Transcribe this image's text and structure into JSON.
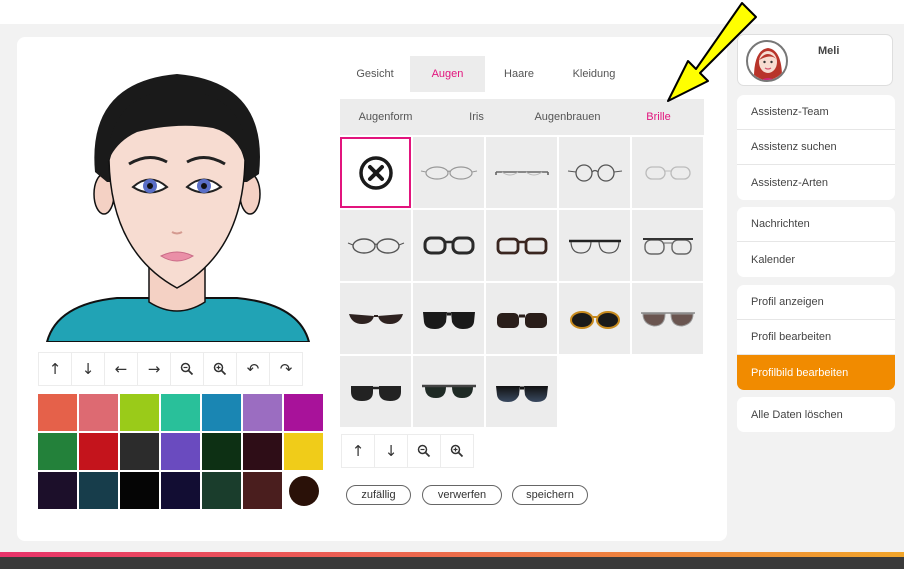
{
  "colors": {
    "accent": "#e2147d",
    "active_nav": "#f18b00",
    "annotation_arrow": "#ffff00"
  },
  "avatar": {
    "icon": "female-face-avatar"
  },
  "editor": {
    "move_tools": [
      {
        "icon": "arrow-up-icon",
        "glyph": "↑"
      },
      {
        "icon": "arrow-down-icon",
        "glyph": "↓"
      },
      {
        "icon": "arrow-left-icon",
        "glyph": "←"
      },
      {
        "icon": "arrow-right-icon",
        "glyph": "→"
      },
      {
        "icon": "zoom-out-icon",
        "glyph": "zoom-out"
      },
      {
        "icon": "zoom-in-icon",
        "glyph": "zoom-in"
      },
      {
        "icon": "rotate-left-icon",
        "glyph": "↶"
      },
      {
        "icon": "rotate-right-icon",
        "glyph": "↷"
      }
    ],
    "palette": [
      "#e5614a",
      "#dd6a72",
      "#9acb19",
      "#29c09a",
      "#1a86b3",
      "#9b6dc1",
      "#a8129a",
      "#23813a",
      "#c4141c",
      "#2c2c2c",
      "#6a4bbf",
      "#0d3014",
      "#2e0d17",
      "#f0cc19",
      "#1c0f2a",
      "#173d4b",
      "#050505",
      "#120d33",
      "#1a3d2c",
      "#4a1e1e",
      "#2a1108"
    ]
  },
  "tabs": {
    "main": [
      {
        "label": "Gesicht",
        "active": false
      },
      {
        "label": "Augen",
        "active": true
      },
      {
        "label": "Haare",
        "active": false
      },
      {
        "label": "Kleidung",
        "active": false
      }
    ],
    "sub": [
      {
        "label": "Augenform",
        "active": false
      },
      {
        "label": "Iris",
        "active": false
      },
      {
        "label": "Augenbrauen",
        "active": false
      },
      {
        "label": "Brille",
        "active": true
      }
    ]
  },
  "glasses": {
    "none_icon": "no-glasses-icon",
    "items": [
      "none",
      "thin-oval",
      "rimless-bar",
      "round-wire",
      "thin-light",
      "wide-oval",
      "thick-dark",
      "thick-brown",
      "browline",
      "clubmaster",
      "sunglasses-cat",
      "sunglasses-wayfarer",
      "sunglasses-brown",
      "sunglasses-gold",
      "sunglasses-aviator",
      "sunglasses-round",
      "sunglasses-green",
      "sunglasses-gradient"
    ]
  },
  "glasses_tools": [
    {
      "icon": "arrow-up-icon",
      "glyph": "↑"
    },
    {
      "icon": "arrow-down-icon",
      "glyph": "↓"
    },
    {
      "icon": "zoom-out-icon",
      "glyph": "zoom-out"
    },
    {
      "icon": "zoom-in-icon",
      "glyph": "zoom-in"
    }
  ],
  "actions": {
    "random": "zufällig",
    "discard": "verwerfen",
    "save": "speichern"
  },
  "profile": {
    "name": "Meli"
  },
  "sidebar": {
    "group1": [
      "Assistenz-Team",
      "Assistenz suchen",
      "Assistenz-Arten"
    ],
    "group2": [
      "Nachrichten",
      "Kalender"
    ],
    "group3": [
      {
        "label": "Profil anzeigen",
        "active": false
      },
      {
        "label": "Profil bearbeiten",
        "active": false
      },
      {
        "label": "Profilbild bearbeiten",
        "active": true
      }
    ],
    "group4": [
      "Alle Daten löschen"
    ]
  }
}
